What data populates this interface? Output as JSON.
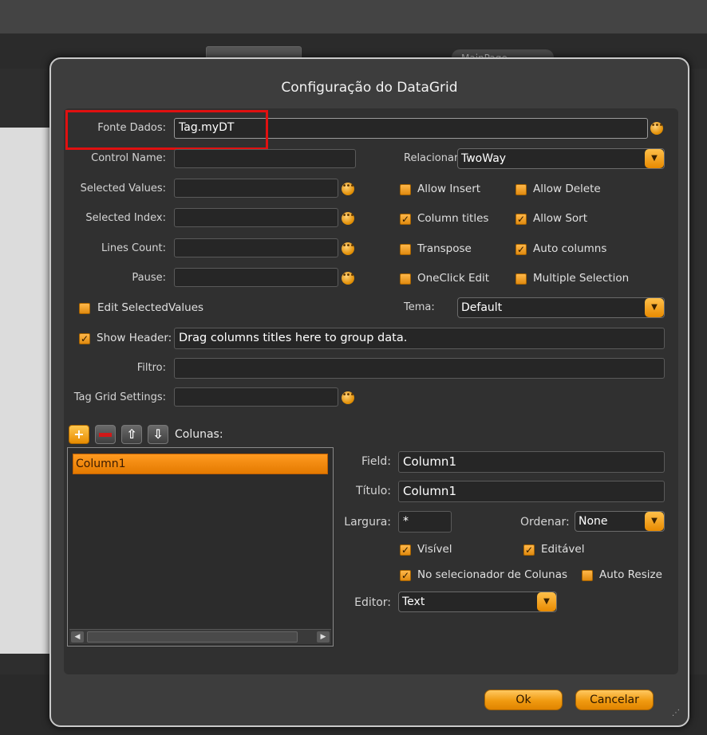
{
  "background": {
    "page_tab": "MainPage"
  },
  "dialog": {
    "title": "Configuração do DataGrid",
    "fonte_dados": {
      "label": "Fonte Dados:",
      "value": "Tag.myDT"
    },
    "control_name": {
      "label": "Control Name:",
      "value": ""
    },
    "selected_values": {
      "label": "Selected Values:",
      "value": ""
    },
    "selected_index": {
      "label": "Selected Index:",
      "value": ""
    },
    "lines_count": {
      "label": "Lines Count:",
      "value": ""
    },
    "pause": {
      "label": "Pause:",
      "value": ""
    },
    "relacionar": {
      "label": "Relacionar",
      "value": "TwoWay"
    },
    "checkboxes": {
      "allow_insert": {
        "label": "Allow Insert",
        "checked": false
      },
      "allow_delete": {
        "label": "Allow Delete",
        "checked": false
      },
      "column_titles": {
        "label": "Column titles",
        "checked": true
      },
      "allow_sort": {
        "label": "Allow Sort",
        "checked": true
      },
      "transpose": {
        "label": "Transpose",
        "checked": false
      },
      "auto_columns": {
        "label": "Auto columns",
        "checked": true
      },
      "oneclick_edit": {
        "label": "OneClick Edit",
        "checked": false
      },
      "multiple_selection": {
        "label": "Multiple Selection",
        "checked": false
      },
      "edit_selected_values": {
        "label": "Edit SelectedValues",
        "checked": false
      },
      "show_header": {
        "label": "Show Header:",
        "checked": true
      }
    },
    "tema": {
      "label": "Tema:",
      "value": "Default"
    },
    "show_header_text": "Drag columns titles here to group data.",
    "filtro": {
      "label": "Filtro:",
      "value": ""
    },
    "tag_grid_settings": {
      "label": "Tag Grid Settings:",
      "value": ""
    },
    "colunas": {
      "label": "Colunas:",
      "items": [
        "Column1"
      ]
    },
    "column_props": {
      "field": {
        "label": "Field:",
        "value": "Column1"
      },
      "titulo": {
        "label": "Título:",
        "value": "Column1"
      },
      "largura": {
        "label": "Largura:",
        "value": "*"
      },
      "ordenar": {
        "label": "Ordenar:",
        "value": "None"
      },
      "visivel": {
        "label": "Visível",
        "checked": true
      },
      "editavel": {
        "label": "Editável",
        "checked": true
      },
      "no_selecionador": {
        "label": "No selecionador de Colunas",
        "checked": true
      },
      "auto_resize": {
        "label": "Auto Resize",
        "checked": false
      },
      "editor": {
        "label": "Editor:",
        "value": "Text"
      }
    },
    "buttons": {
      "ok": "Ok",
      "cancel": "Cancelar"
    }
  }
}
